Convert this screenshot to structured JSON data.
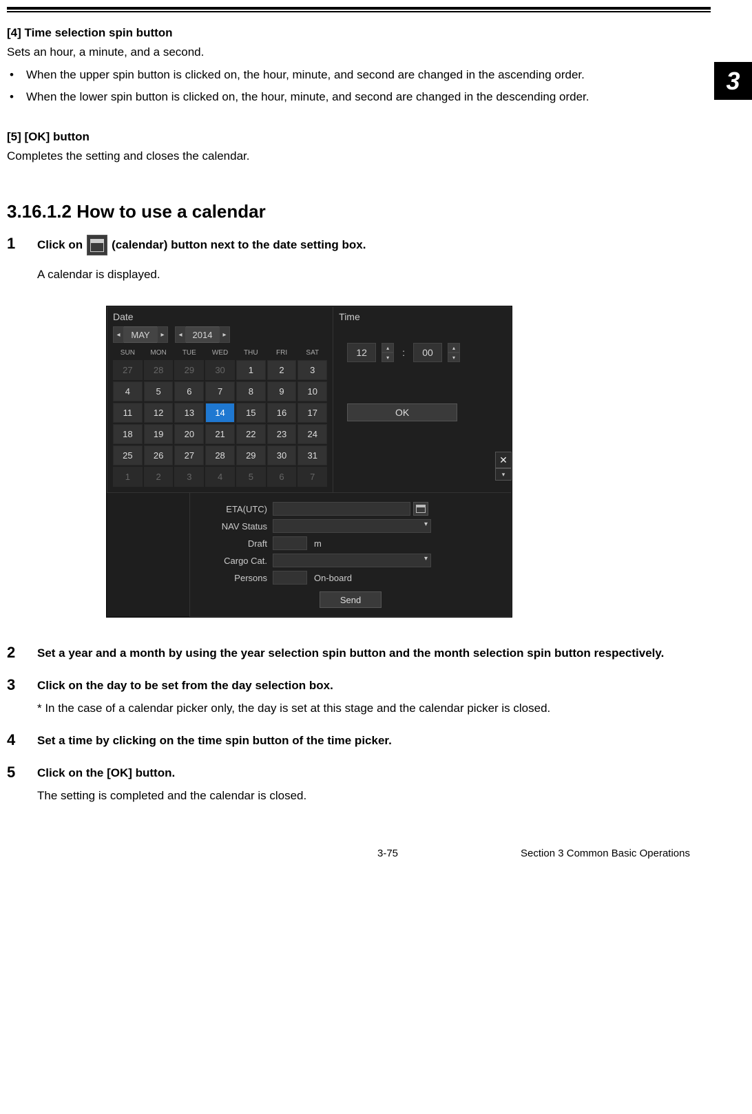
{
  "chapter_tab": "3",
  "sec4": {
    "heading": "[4]  Time selection spin button",
    "lead": "Sets an hour, a minute, and a second.",
    "bullets": [
      "When the upper spin button is clicked on, the hour, minute, and second are changed in the ascending order.",
      "When the lower spin button is clicked on, the hour, minute, and second are changed in the descending order."
    ]
  },
  "sec5": {
    "heading": "[5]  [OK] button",
    "lead": "Completes the setting and closes the calendar."
  },
  "h3": "3.16.1.2   How to use a calendar",
  "steps": {
    "s1": {
      "num": "1",
      "head_pre": "Click on",
      "head_post": "(calendar) button next to the date setting box.",
      "desc": "A calendar is displayed."
    },
    "s2": {
      "num": "2",
      "head": "Set a year and a month by using the year selection spin button and the month selection spin button respectively."
    },
    "s3": {
      "num": "3",
      "head": "Click on the day to be set from the day selection box.",
      "desc": "* In the case of a calendar picker only, the day is set at this stage and the calendar picker is closed."
    },
    "s4": {
      "num": "4",
      "head": "Set a time by clicking on the time spin button of the time picker."
    },
    "s5": {
      "num": "5",
      "head": "Click on the [OK] button.",
      "desc": "The setting is completed and the calendar is closed."
    }
  },
  "calendar": {
    "date_label": "Date",
    "time_label": "Time",
    "month": "MAY",
    "year": "2014",
    "dow": [
      "SUN",
      "MON",
      "TUE",
      "WED",
      "THU",
      "FRI",
      "SAT"
    ],
    "cells": [
      {
        "t": "27",
        "dim": true
      },
      {
        "t": "28",
        "dim": true
      },
      {
        "t": "29",
        "dim": true
      },
      {
        "t": "30",
        "dim": true
      },
      {
        "t": "1"
      },
      {
        "t": "2"
      },
      {
        "t": "3"
      },
      {
        "t": "4"
      },
      {
        "t": "5"
      },
      {
        "t": "6"
      },
      {
        "t": "7"
      },
      {
        "t": "8"
      },
      {
        "t": "9"
      },
      {
        "t": "10"
      },
      {
        "t": "11"
      },
      {
        "t": "12"
      },
      {
        "t": "13"
      },
      {
        "t": "14",
        "sel": true
      },
      {
        "t": "15"
      },
      {
        "t": "16"
      },
      {
        "t": "17"
      },
      {
        "t": "18"
      },
      {
        "t": "19"
      },
      {
        "t": "20"
      },
      {
        "t": "21"
      },
      {
        "t": "22"
      },
      {
        "t": "23"
      },
      {
        "t": "24"
      },
      {
        "t": "25"
      },
      {
        "t": "26"
      },
      {
        "t": "27"
      },
      {
        "t": "28"
      },
      {
        "t": "29"
      },
      {
        "t": "30"
      },
      {
        "t": "31"
      },
      {
        "t": "1",
        "dim": true
      },
      {
        "t": "2",
        "dim": true
      },
      {
        "t": "3",
        "dim": true
      },
      {
        "t": "4",
        "dim": true
      },
      {
        "t": "5",
        "dim": true
      },
      {
        "t": "6",
        "dim": true
      },
      {
        "t": "7",
        "dim": true
      }
    ],
    "hour": "12",
    "minute": "00",
    "ok": "OK"
  },
  "form": {
    "eta_lbl": "ETA(UTC)",
    "nav_lbl": "NAV Status",
    "draft_lbl": "Draft",
    "draft_unit": "m",
    "cargo_lbl": "Cargo Cat.",
    "persons_lbl": "Persons",
    "persons_unit": "On-board",
    "send": "Send"
  },
  "footer": {
    "page": "3-75",
    "section": "Section 3   Common Basic Operations"
  }
}
